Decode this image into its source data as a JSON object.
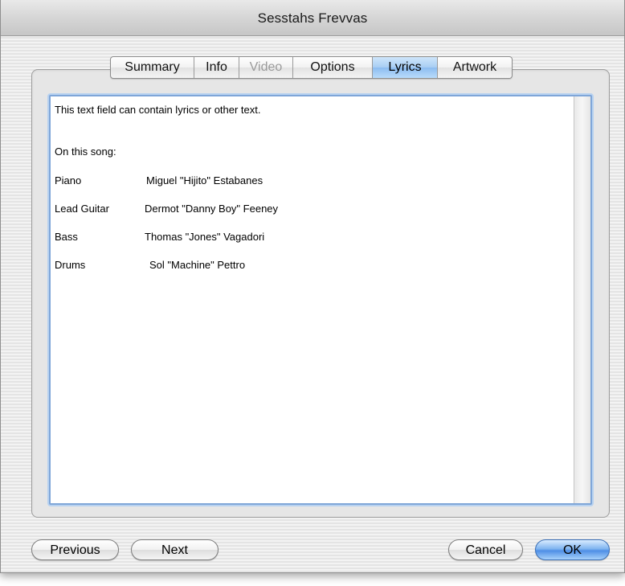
{
  "window": {
    "title": "Sesstahs Frevvas"
  },
  "tabs": [
    {
      "label": "Summary",
      "state": "normal"
    },
    {
      "label": "Info",
      "state": "normal"
    },
    {
      "label": "Video",
      "state": "disabled"
    },
    {
      "label": "Options",
      "state": "normal"
    },
    {
      "label": "Lyrics",
      "state": "selected"
    },
    {
      "label": "Artwork",
      "state": "normal"
    }
  ],
  "lyrics": {
    "intro": "This text field can contain lyrics or other text.",
    "section_heading": "On this song:",
    "credits": [
      {
        "role": "Piano",
        "name": "Miguel \"Hijito\" Estabanes"
      },
      {
        "role": "Lead Guitar",
        "name": "Dermot \"Danny Boy\" Feeney"
      },
      {
        "role": "Bass",
        "name": "Thomas \"Jones\" Vagadori"
      },
      {
        "role": "Drums",
        "name": "Sol \"Machine\" Pettro"
      }
    ]
  },
  "buttons": {
    "previous": "Previous",
    "next": "Next",
    "cancel": "Cancel",
    "ok": "OK"
  },
  "colors": {
    "selected_tab": "#a7cdf3",
    "focus_ring": "#7fa6d8",
    "default_button": "#4f8fe6"
  }
}
